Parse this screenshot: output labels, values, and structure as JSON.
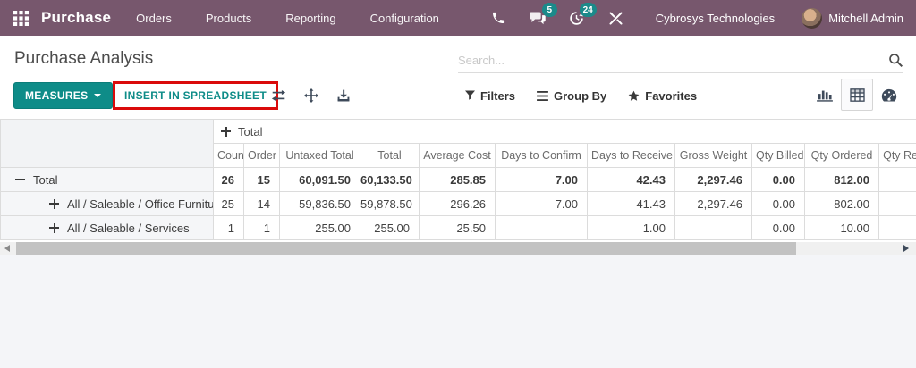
{
  "colors": {
    "nav_bg": "#77576d",
    "accent_teal": "#0e8c88",
    "badge_teal": "#1b8a8a",
    "annotation_red": "#da0b0b"
  },
  "nav": {
    "app_name": "Purchase",
    "menus": [
      "Orders",
      "Products",
      "Reporting",
      "Configuration"
    ],
    "message_badge": "5",
    "activity_badge": "24",
    "company": "Cybrosys Technologies",
    "user": "Mitchell Admin"
  },
  "header": {
    "title": "Purchase Analysis"
  },
  "search": {
    "placeholder": "Search..."
  },
  "controls": {
    "measures_label": "MEASURES",
    "insert_spreadsheet_label": "INSERT IN SPREADSHEET",
    "filters_label": "Filters",
    "group_by_label": "Group By",
    "favorites_label": "Favorites"
  },
  "table": {
    "group_header": "Total",
    "columns": [
      "Count",
      "Order",
      "Untaxed Total",
      "Total",
      "Average Cost",
      "Days to Confirm",
      "Days to Receive",
      "Gross Weight",
      "Qty Billed",
      "Qty Ordered",
      "Qty Re"
    ],
    "rows": [
      {
        "label": "Total",
        "expander": "minus",
        "cells": [
          "26",
          "15",
          "60,091.50",
          "60,133.50",
          "285.85",
          "7.00",
          "42.43",
          "2,297.46",
          "0.00",
          "812.00",
          ""
        ]
      },
      {
        "label": "All / Saleable / Office Furniture",
        "expander": "plus",
        "cells": [
          "25",
          "14",
          "59,836.50",
          "59,878.50",
          "296.26",
          "7.00",
          "41.43",
          "2,297.46",
          "0.00",
          "802.00",
          ""
        ]
      },
      {
        "label": "All / Saleable / Services",
        "expander": "plus",
        "cells": [
          "1",
          "1",
          "255.00",
          "255.00",
          "25.50",
          "",
          "1.00",
          "",
          "0.00",
          "10.00",
          ""
        ]
      }
    ]
  }
}
